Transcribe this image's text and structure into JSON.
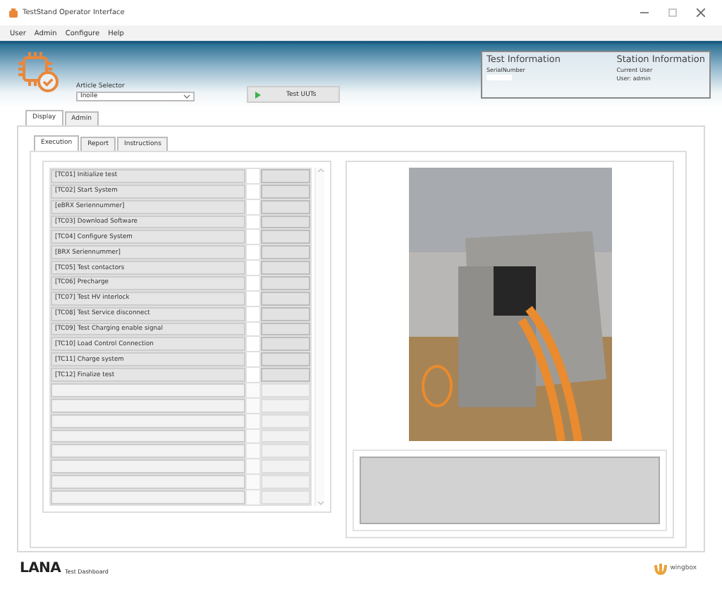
{
  "window": {
    "title": "TestStand Operator Interface"
  },
  "menu": [
    "User",
    "Admin",
    "Configure",
    "Help"
  ],
  "banner": {
    "article_selector": {
      "label": "Article Selector",
      "value": "Inoile"
    },
    "run_button": "Test UUTs",
    "test_information": {
      "title": "Test Information",
      "serial_label": "SerialNumber"
    },
    "station_information": {
      "title": "Station Information",
      "lines": [
        "Current User",
        "User: admin"
      ]
    }
  },
  "tabs": [
    {
      "label": "Display",
      "selected": true
    },
    {
      "label": "Admin",
      "selected": false
    }
  ],
  "subtabs": [
    {
      "label": "Execution",
      "selected": true
    },
    {
      "label": "Report",
      "selected": false
    },
    {
      "label": "Instructions",
      "selected": false
    }
  ],
  "steps": [
    {
      "name": "[TC01] Initialize test",
      "checked": false
    },
    {
      "name": "[TC02] Start System",
      "checked": false
    },
    {
      "name": "[eBRX Seriennummer]",
      "checked": false
    },
    {
      "name": "[TC03] Download Software",
      "checked": false
    },
    {
      "name": "[TC04] Configure System",
      "checked": false
    },
    {
      "name": "[BRX Seriennummer]",
      "checked": false
    },
    {
      "name": "[TC05] Test contactors",
      "checked": false
    },
    {
      "name": "[TC06] Precharge",
      "checked": false
    },
    {
      "name": "[TC07] Test HV interlock",
      "checked": false
    },
    {
      "name": "[TC08] Test Service disconnect",
      "checked": false
    },
    {
      "name": "[TC09] Test Charging enable signal",
      "checked": false
    },
    {
      "name": "[TC10] Load Control Connection",
      "checked": false
    },
    {
      "name": "[TC11] Charge system",
      "checked": false
    },
    {
      "name": "[TC12] Finalize test",
      "checked": false
    }
  ],
  "footer": {
    "brand": "LANA",
    "subtitle": "Test Dashboard",
    "partner": "wingbox"
  }
}
